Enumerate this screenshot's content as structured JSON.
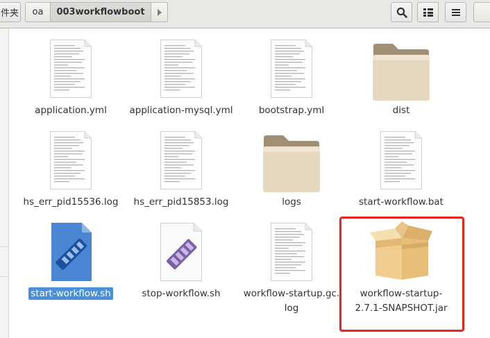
{
  "breadcrumb": {
    "partial_label": "件夹",
    "items": [
      "oa",
      "003workflowboot"
    ]
  },
  "toolbar": {
    "search_icon": "search-icon",
    "view_icon": "view-options-icon",
    "menu_icon": "hamburger-menu-icon"
  },
  "colors": {
    "selection": "#4a90d9",
    "highlight_border": "#e8251d"
  },
  "files": [
    {
      "name": "application.yml",
      "type": "text-document-icon"
    },
    {
      "name": "application-mysql.yml",
      "type": "text-document-icon"
    },
    {
      "name": "bootstrap.yml",
      "type": "text-document-icon"
    },
    {
      "name": "dist",
      "type": "folder-icon"
    },
    {
      "name": "hs_err_pid15536.log",
      "type": "text-document-icon"
    },
    {
      "name": "hs_err_pid15853.log",
      "type": "text-document-icon"
    },
    {
      "name": "logs",
      "type": "folder-icon"
    },
    {
      "name": "start-workflow.bat",
      "type": "text-document-icon"
    },
    {
      "name": "start-workflow.sh",
      "type": "shell-script-icon",
      "selected": true
    },
    {
      "name": "stop-workflow.sh",
      "type": "shell-script-icon"
    },
    {
      "name_line1": "workflow-startup.gc.",
      "name_line2": "log",
      "type": "text-document-icon"
    },
    {
      "name_line1": "workflow-startup-",
      "name_line2": "2.7.1-SNAPSHOT.jar",
      "type": "jar-package-icon",
      "highlighted": true
    }
  ]
}
